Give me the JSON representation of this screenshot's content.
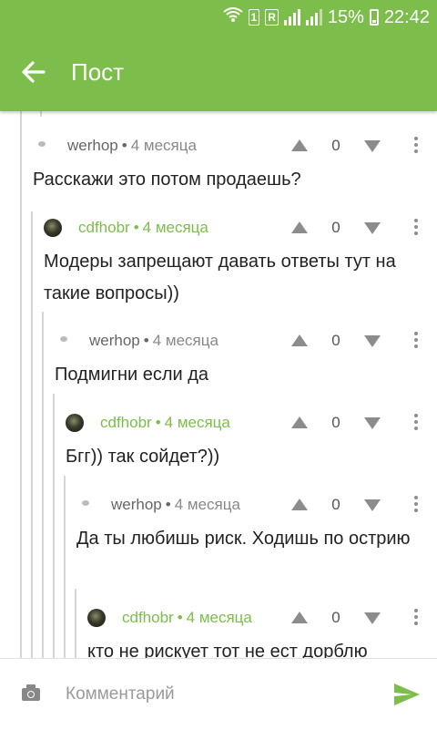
{
  "status_bar": {
    "battery": "15%",
    "time": "22:42",
    "sim_label": "1",
    "roaming_label": "R"
  },
  "app_bar": {
    "title": "Пост"
  },
  "comments": [
    {
      "author": "werhop",
      "date": "4 месяца",
      "score": "0",
      "text": "Расскажи это потом продаешь?"
    },
    {
      "author": "cdfhobr",
      "date": "4 месяца",
      "score": "0",
      "text": "Модеры запрещают давать ответы тут на такие вопросы))"
    },
    {
      "author": "werhop",
      "date": "4 месяца",
      "score": "0",
      "text": "Подмигни если да"
    },
    {
      "author": "cdfhobr",
      "date": "4 месяца",
      "score": "0",
      "text": "Бгг)) так сойдет?))"
    },
    {
      "author": "werhop",
      "date": "4 месяца",
      "score": "0",
      "text": "Да ты любишь риск. Ходишь по острию"
    },
    {
      "author": "cdfhobr",
      "date": "4 месяца",
      "score": "0",
      "text": "кто не рискует тот не ест дорблю"
    }
  ],
  "comment_input": {
    "placeholder": "Комментарий"
  },
  "colors": {
    "accent": "#7cbd4b",
    "text": "#222222",
    "muted": "#8c8c8c"
  }
}
